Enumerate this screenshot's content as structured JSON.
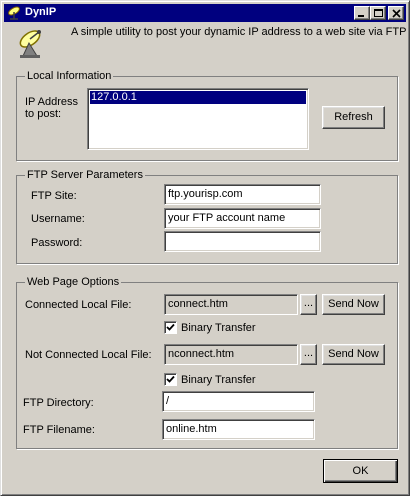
{
  "window": {
    "title": "DynIP"
  },
  "header": {
    "description": "A simple utility to post your dynamic IP address to a web site via FTP"
  },
  "local_info": {
    "group_label": "Local Information",
    "ip_label_line1": "IP Address",
    "ip_label_line2": "to post:",
    "ip_list": [
      "127.0.0.1"
    ],
    "refresh_label": "Refresh"
  },
  "ftp_server": {
    "group_label": "FTP Server Parameters",
    "site_label": "FTP Site:",
    "site_value": "ftp.yourisp.com",
    "username_label": "Username:",
    "username_value": "your FTP account name",
    "password_label": "Password:",
    "password_value": ""
  },
  "web_page": {
    "group_label": "Web Page Options",
    "connected_label": "Connected Local File:",
    "connected_value": "connect.htm",
    "browse_label": "...",
    "send_now_label": "Send Now",
    "binary_transfer_label": "Binary Transfer",
    "binary_transfer_1_checked": true,
    "not_connected_label": "Not Connected Local File:",
    "not_connected_value": "nconnect.htm",
    "binary_transfer_2_checked": true,
    "ftp_directory_label": "FTP Directory:",
    "ftp_directory_value": "/",
    "ftp_filename_label": "FTP Filename:",
    "ftp_filename_value": "online.htm"
  },
  "ok_label": "OK"
}
